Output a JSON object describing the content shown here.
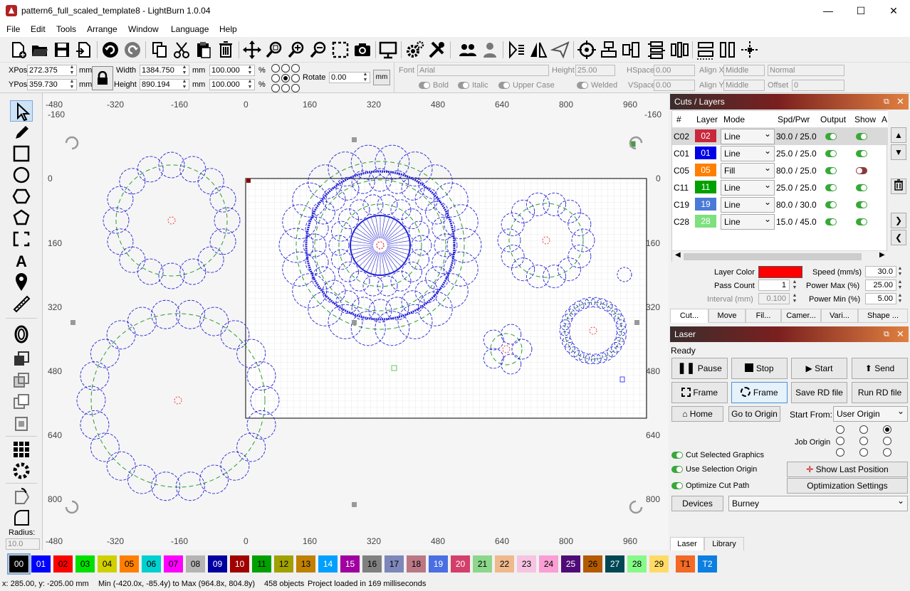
{
  "window": {
    "title": "pattern6_full_scaled_template8 - LightBurn 1.0.04"
  },
  "menu": [
    "File",
    "Edit",
    "Tools",
    "Arrange",
    "Window",
    "Language",
    "Help"
  ],
  "position": {
    "xpos_label": "XPos",
    "xpos_value": "272.375",
    "ypos_label": "YPos",
    "ypos_value": "359.730",
    "unit": "mm",
    "width_label": "Width",
    "width_value": "1384.750",
    "height_label": "Height",
    "height_value": "890.194",
    "scale_w": "100.000",
    "scale_h": "100.000",
    "pct": "%",
    "rotate_label": "Rotate",
    "rotate_value": "0.00",
    "mm_button": "mm"
  },
  "font_bar": {
    "font_label": "Font",
    "font_value": "Arial",
    "height_label": "Height",
    "height_value": "25.00",
    "hspace_label": "HSpace",
    "hspace_value": "0.00",
    "vspace_label": "VSpace",
    "vspace_value": "0.00",
    "alignx_label": "Align X",
    "alignx_value": "Middle",
    "aligny_label": "Align Y",
    "aligny_value": "Middle",
    "mode_value": "Normal",
    "offset_label": "Offset",
    "offset_value": "0",
    "bold": "Bold",
    "italic": "Italic",
    "upper": "Upper Case",
    "welded": "Welded"
  },
  "rulers": {
    "top": [
      "-480",
      "-320",
      "-160",
      "0",
      "160",
      "320",
      "480",
      "640",
      "800",
      "960"
    ],
    "top_extra": "-160",
    "left": [
      "0",
      "160",
      "320",
      "480",
      "640",
      "800"
    ],
    "right": [
      "0",
      "160",
      "320",
      "480",
      "640",
      "800"
    ],
    "right_top": "-160"
  },
  "cuts_panel": {
    "title": "Cuts / Layers",
    "headers": [
      "#",
      "Layer",
      "Mode",
      "Spd/Pwr",
      "Output",
      "Show",
      "A"
    ],
    "rows": [
      {
        "id": "C02",
        "layer": "02",
        "color": "#c8283c",
        "mode": "Line",
        "spd": "30.0 / 25.0",
        "output": true,
        "show": true
      },
      {
        "id": "C01",
        "layer": "01",
        "color": "#0000e6",
        "mode": "Line",
        "spd": "25.0 / 25.0",
        "output": true,
        "show": true
      },
      {
        "id": "C05",
        "layer": "05",
        "color": "#ff7f00",
        "mode": "Fill",
        "spd": "80.0 / 25.0",
        "output": true,
        "show": false
      },
      {
        "id": "C11",
        "layer": "11",
        "color": "#00a000",
        "mode": "Line",
        "spd": "25.0 / 25.0",
        "output": true,
        "show": true
      },
      {
        "id": "C19",
        "layer": "19",
        "color": "#4a7ad8",
        "mode": "Line",
        "spd": "80.0 / 30.0",
        "output": true,
        "show": true
      },
      {
        "id": "C28",
        "layer": "28",
        "color": "#7ee07e",
        "mode": "Line",
        "spd": "15.0 / 45.0",
        "output": true,
        "show": true
      }
    ],
    "layer_color_label": "Layer Color",
    "speed_label": "Speed (mm/s)",
    "speed_value": "30.0",
    "pass_label": "Pass Count",
    "pass_value": "1",
    "pmax_label": "Power Max (%)",
    "pmax_value": "25.00",
    "interval_label": "Interval (mm)",
    "interval_value": "0.100",
    "pmin_label": "Power Min (%)",
    "pmin_value": "5.00",
    "tabs": [
      "Cut...",
      "Move",
      "Fil...",
      "Camer...",
      "Vari...",
      "Shape ..."
    ]
  },
  "laser_panel": {
    "title": "Laser",
    "status": "Ready",
    "pause": "Pause",
    "stop": "Stop",
    "start": "Start",
    "send": "Send",
    "frame1": "Frame",
    "frame2": "Frame",
    "save_rd": "Save RD file",
    "run_rd": "Run RD file",
    "home": "Home",
    "go_origin": "Go to Origin",
    "start_from_label": "Start From:",
    "start_from_value": "User Origin",
    "job_origin_label": "Job Origin",
    "cut_selected": "Cut Selected Graphics",
    "use_selection": "Use Selection Origin",
    "optimize": "Optimize Cut Path",
    "show_last": "Show Last Position",
    "opt_settings": "Optimization Settings",
    "devices": "Devices",
    "device_value": "Burney",
    "bottom_tabs": [
      "Laser",
      "Library"
    ]
  },
  "left_tools": {
    "radius_label": "Radius:",
    "radius_value": "10.0"
  },
  "palette": [
    {
      "l": "00",
      "c": "#000000",
      "t": "#fff"
    },
    {
      "l": "01",
      "c": "#0000ff",
      "t": "#fff"
    },
    {
      "l": "02",
      "c": "#ff0000",
      "t": "#000"
    },
    {
      "l": "03",
      "c": "#00e000",
      "t": "#000"
    },
    {
      "l": "04",
      "c": "#d0d000",
      "t": "#000"
    },
    {
      "l": "05",
      "c": "#ff8000",
      "t": "#000"
    },
    {
      "l": "06",
      "c": "#00d0d0",
      "t": "#000"
    },
    {
      "l": "07",
      "c": "#ff00ff",
      "t": "#000"
    },
    {
      "l": "08",
      "c": "#b4b4b4",
      "t": "#000"
    },
    {
      "l": "09",
      "c": "#0000a0",
      "t": "#fff"
    },
    {
      "l": "10",
      "c": "#a00000",
      "t": "#fff"
    },
    {
      "l": "11",
      "c": "#00a000",
      "t": "#000"
    },
    {
      "l": "12",
      "c": "#a0a000",
      "t": "#000"
    },
    {
      "l": "13",
      "c": "#c08000",
      "t": "#000"
    },
    {
      "l": "14",
      "c": "#00a0ff",
      "t": "#fff"
    },
    {
      "l": "15",
      "c": "#a000a0",
      "t": "#fff"
    },
    {
      "l": "16",
      "c": "#808080",
      "t": "#000"
    },
    {
      "l": "17",
      "c": "#7d87b9",
      "t": "#000"
    },
    {
      "l": "18",
      "c": "#bb7784",
      "t": "#000"
    },
    {
      "l": "19",
      "c": "#4a6fe3",
      "t": "#fff"
    },
    {
      "l": "20",
      "c": "#d33f6a",
      "t": "#fff"
    },
    {
      "l": "21",
      "c": "#8cd78c",
      "t": "#000"
    },
    {
      "l": "22",
      "c": "#f0b98d",
      "t": "#000"
    },
    {
      "l": "23",
      "c": "#f6c4e1",
      "t": "#000"
    },
    {
      "l": "24",
      "c": "#fa9ed4",
      "t": "#000"
    },
    {
      "l": "25",
      "c": "#500a78",
      "t": "#fff"
    },
    {
      "l": "26",
      "c": "#b45a00",
      "t": "#000"
    },
    {
      "l": "27",
      "c": "#004754",
      "t": "#fff"
    },
    {
      "l": "28",
      "c": "#86fa88",
      "t": "#000"
    },
    {
      "l": "29",
      "c": "#ffdb66",
      "t": "#000"
    },
    {
      "l": "T1",
      "c": "#f36926",
      "t": "#000"
    },
    {
      "l": "T2",
      "c": "#0c7fe0",
      "t": "#fff"
    }
  ],
  "status": {
    "coords": "x: 285.00, y: -205.00 mm",
    "bounds": "Min (-420.0x, -85.4y) to Max (964.8x, 804.8y)",
    "objects": "458 objects",
    "loaded": "Project loaded in 169 milliseconds"
  }
}
